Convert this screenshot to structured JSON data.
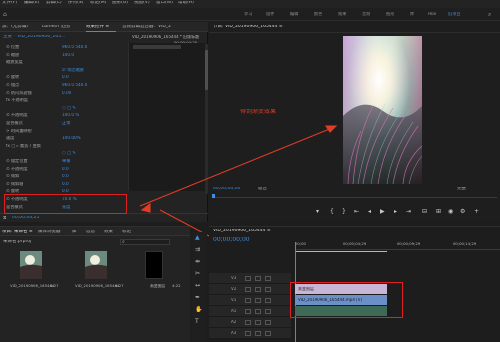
{
  "menu": [
    "文件(F)",
    "编辑(E)",
    "剪辑(C)",
    "序列(S)",
    "标记(M)",
    "图形(G)",
    "视图(V)",
    "窗口(W)",
    "帮助(H)"
  ],
  "workspaces": [
    "学习",
    "组件",
    "编辑",
    "颜色",
    "效果",
    "音频",
    "图形",
    "库",
    "Hbe",
    "旧项目"
  ],
  "ec_tabs": [
    "源：(无剪辑)",
    "Lumetri 范围",
    "效果控件 ≡",
    "音频剪辑混合器：VID_2"
  ],
  "ec_header": {
    "master": "主要 * VID_20190906_165...",
    "seq": "VID_20190906_165444 * 旧版标题",
    "time": "00;00;04;25"
  },
  "ec_rows": [
    {
      "label": "⊙ 位置",
      "value": "960.0   540.0"
    },
    {
      "label": "⊙ 缩放",
      "value": "100.0"
    },
    {
      "label": "   缩放宽度",
      "value": ""
    },
    {
      "label": "",
      "value": "☑ 等比缩放"
    },
    {
      "label": "⊙ 旋转",
      "value": "0.0"
    },
    {
      "label": "⊙ 锚点",
      "value": "960.0   540.0"
    },
    {
      "label": "⊙ 防闪烁滤镜",
      "value": "0.00"
    },
    {
      "label": "fx 不透明度",
      "value": ""
    },
    {
      "label": "",
      "value": "○ □ ✎"
    },
    {
      "label": "⊙ 不透明度",
      "value": "100.0 %"
    },
    {
      "label": "   混合模式",
      "value": "正常"
    },
    {
      "label": "> 时间重映射",
      "value": ""
    },
    {
      "label": "   速度",
      "value": "100.00%"
    },
    {
      "label": "fx ▢ ▹ 裁剪 / 变换",
      "value": ""
    },
    {
      "label": "",
      "value": "○ □ ✎"
    },
    {
      "label": "⊙ 锚定位置",
      "value": "单像"
    },
    {
      "label": "⊙ 不透明度",
      "value": "0.0"
    },
    {
      "label": "⊙ 倾斜",
      "value": "0.0"
    },
    {
      "label": "⊙ 倾斜轴",
      "value": "0.0"
    },
    {
      "label": "⊙ 旋转",
      "value": "0.0"
    },
    {
      "label": "⊙ 不透明度",
      "value": "70.0 %"
    },
    {
      "label": "   混合模式",
      "value": "亮度"
    }
  ],
  "ec_timecode": "00;00;04;25",
  "preview": {
    "tab": "节目: VID_20190906_165444 ≡",
    "annotation": "得到渐变效果",
    "timecode": "00;00;00;00",
    "fit": "适合",
    "quality": "完整",
    "end_time": "00;00;06;25"
  },
  "project": {
    "tabs": [
      "项目: 未命名 ≡",
      "媒体浏览器",
      "库",
      "信息",
      "效果",
      "标记"
    ],
    "path": "未命名.prproj",
    "search_placeholder": "",
    "items": [
      {
        "name": "VID_20190906_165444",
        "duration": "6:27"
      },
      {
        "name": "VID_20190906_165444",
        "duration": "6:27"
      },
      {
        "name": "渐变图层",
        "duration": "4:22"
      }
    ]
  },
  "timeline": {
    "tab": "VID_20190906_165444 ≡",
    "timecode": "00;00;00;00",
    "ruler": [
      "00;00",
      "00;00;04;29",
      "00;00;09;29",
      "00;00;14;29"
    ],
    "tracks": [
      {
        "name": "V3"
      },
      {
        "name": "V2"
      },
      {
        "name": "V1"
      },
      {
        "name": "A1"
      },
      {
        "name": "A2"
      },
      {
        "name": "A3"
      }
    ],
    "clips": [
      "渐变图层",
      "VID_20190906_165444.mp4 [V]",
      ""
    ]
  },
  "colors": {
    "accent_blue": "#3f8fe0",
    "highlight_red": "#e02020",
    "annotation_red": "#e23c26"
  }
}
